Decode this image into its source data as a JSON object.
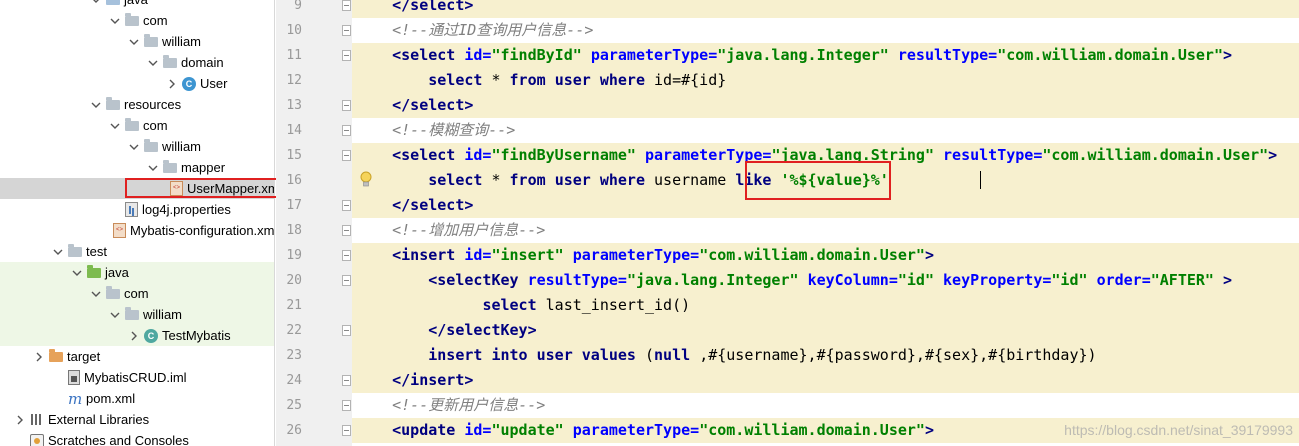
{
  "project_tree": [
    {
      "label": "java",
      "depth": 4,
      "icon": "folder-blue-icon",
      "expanded": true,
      "green": false
    },
    {
      "label": "com",
      "depth": 5,
      "icon": "folder-grey-icon",
      "expanded": true,
      "green": false
    },
    {
      "label": "william",
      "depth": 6,
      "icon": "folder-grey-icon",
      "expanded": true,
      "green": false
    },
    {
      "label": "domain",
      "depth": 7,
      "icon": "folder-grey-icon",
      "expanded": true,
      "green": false
    },
    {
      "label": "User",
      "depth": 8,
      "icon": "class-icon",
      "expanded": false,
      "green": false
    },
    {
      "label": "resources",
      "depth": 4,
      "icon": "folder-grey-icon",
      "expanded": true,
      "green": false
    },
    {
      "label": "com",
      "depth": 5,
      "icon": "folder-grey-icon",
      "expanded": true,
      "green": false
    },
    {
      "label": "william",
      "depth": 6,
      "icon": "folder-grey-icon",
      "expanded": true,
      "green": false
    },
    {
      "label": "mapper",
      "depth": 7,
      "icon": "folder-grey-icon",
      "expanded": true,
      "green": false
    },
    {
      "label": "UserMapper.xml",
      "depth": 8,
      "icon": "xml-file-icon",
      "selected": true,
      "green": false
    },
    {
      "label": "log4j.properties",
      "depth": 5,
      "icon": "properties-file-icon",
      "green": false
    },
    {
      "label": "Mybatis-configuration.xml",
      "depth": 5,
      "icon": "xml-file-icon",
      "green": false
    },
    {
      "label": "test",
      "depth": 2,
      "icon": "folder-grey-icon",
      "expanded": true,
      "green": false
    },
    {
      "label": "java",
      "depth": 3,
      "icon": "folder-green-icon",
      "expanded": true,
      "green": true
    },
    {
      "label": "com",
      "depth": 4,
      "icon": "folder-grey-icon",
      "expanded": true,
      "green": true
    },
    {
      "label": "william",
      "depth": 5,
      "icon": "folder-grey-icon",
      "expanded": true,
      "green": true
    },
    {
      "label": "TestMybatis",
      "depth": 6,
      "icon": "test-class-icon",
      "expanded": false,
      "green": true
    },
    {
      "label": "target",
      "depth": 1,
      "icon": "folder-orange-icon",
      "expanded": false,
      "green": false
    },
    {
      "label": "MybatisCRUD.iml",
      "depth": 2,
      "icon": "iml-file-icon",
      "green": false
    },
    {
      "label": "pom.xml",
      "depth": 2,
      "icon": "maven-icon",
      "green": false
    },
    {
      "label": "External Libraries",
      "depth": 0,
      "icon": "libraries-icon",
      "expanded": false,
      "green": false
    },
    {
      "label": "Scratches and Consoles",
      "depth": 0,
      "icon": "scratches-icon",
      "green": false
    }
  ],
  "code_lines": [
    {
      "n": "9",
      "fold": true,
      "block": true,
      "tokens": [
        [
          "guide",
          "    "
        ],
        [
          "tag",
          "</select>"
        ]
      ]
    },
    {
      "n": "10",
      "fold": true,
      "block": false,
      "tokens": [
        [
          "guide",
          "    "
        ],
        [
          "comment",
          "<!--通过ID查询用户信息-->"
        ]
      ]
    },
    {
      "n": "11",
      "fold": true,
      "block": true,
      "tokens": [
        [
          "guide",
          "    "
        ],
        [
          "tag",
          "<select "
        ],
        [
          "attr",
          "id="
        ],
        [
          "val",
          "\"findById\" "
        ],
        [
          "attr",
          "parameterType="
        ],
        [
          "val",
          "\"java.lang.Integer\" "
        ],
        [
          "attr",
          "resultType="
        ],
        [
          "val",
          "\"com.william.domain.User\""
        ],
        [
          "tag",
          ">"
        ]
      ]
    },
    {
      "n": "12",
      "fold": false,
      "block": true,
      "tokens": [
        [
          "guide",
          "        "
        ],
        [
          "kw",
          "select "
        ],
        [
          "plain",
          "* "
        ],
        [
          "kw",
          "from "
        ],
        [
          "kw",
          "user "
        ],
        [
          "kw",
          "where "
        ],
        [
          "plain",
          "id=#{id}"
        ]
      ]
    },
    {
      "n": "13",
      "fold": true,
      "block": true,
      "tokens": [
        [
          "guide",
          "    "
        ],
        [
          "tag",
          "</select>"
        ]
      ]
    },
    {
      "n": "14",
      "fold": true,
      "block": false,
      "tokens": [
        [
          "guide",
          "    "
        ],
        [
          "comment",
          "<!--模糊查询-->"
        ]
      ]
    },
    {
      "n": "15",
      "fold": true,
      "block": true,
      "tokens": [
        [
          "guide",
          "    "
        ],
        [
          "tag",
          "<select "
        ],
        [
          "attr",
          "id="
        ],
        [
          "val",
          "\"findByUsername\" "
        ],
        [
          "attr",
          "parameterType="
        ],
        [
          "val",
          "\"java.lang.String\" "
        ],
        [
          "attr",
          "resultType="
        ],
        [
          "val",
          "\"com.william.domain.User\""
        ],
        [
          "tag",
          ">"
        ]
      ]
    },
    {
      "n": "16",
      "fold": false,
      "block": true,
      "bulb": true,
      "tokens": [
        [
          "guide",
          "        "
        ],
        [
          "kw",
          "select "
        ],
        [
          "plain",
          "* "
        ],
        [
          "kw",
          "from "
        ],
        [
          "kw",
          "user "
        ],
        [
          "kw",
          "where "
        ],
        [
          "plain",
          "username "
        ],
        [
          "kw",
          "like "
        ],
        [
          "val",
          "'%${value}%'"
        ]
      ]
    },
    {
      "n": "17",
      "fold": true,
      "block": true,
      "tokens": [
        [
          "guide",
          "    "
        ],
        [
          "tag",
          "</select>"
        ]
      ]
    },
    {
      "n": "18",
      "fold": true,
      "block": false,
      "tokens": [
        [
          "guide",
          "    "
        ],
        [
          "comment",
          "<!--增加用户信息-->"
        ]
      ]
    },
    {
      "n": "19",
      "fold": true,
      "block": true,
      "tokens": [
        [
          "guide",
          "    "
        ],
        [
          "tag",
          "<insert "
        ],
        [
          "attr",
          "id="
        ],
        [
          "val",
          "\"insert\" "
        ],
        [
          "attr",
          "parameterType="
        ],
        [
          "val",
          "\"com.william.domain.User\""
        ],
        [
          "tag",
          ">"
        ]
      ]
    },
    {
      "n": "20",
      "fold": true,
      "block": true,
      "tokens": [
        [
          "guide",
          "        "
        ],
        [
          "tag",
          "<selectKey "
        ],
        [
          "attr",
          "resultType="
        ],
        [
          "val",
          "\"java.lang.Integer\" "
        ],
        [
          "attr",
          "keyColumn="
        ],
        [
          "val",
          "\"id\" "
        ],
        [
          "attr",
          "keyProperty="
        ],
        [
          "val",
          "\"id\" "
        ],
        [
          "attr",
          "order="
        ],
        [
          "val",
          "\"AFTER\" "
        ],
        [
          "tag",
          ">"
        ]
      ]
    },
    {
      "n": "21",
      "fold": false,
      "block": true,
      "tokens": [
        [
          "guide",
          "              "
        ],
        [
          "kw",
          "select "
        ],
        [
          "plain",
          "last_insert_id()"
        ]
      ]
    },
    {
      "n": "22",
      "fold": true,
      "block": true,
      "tokens": [
        [
          "guide",
          "        "
        ],
        [
          "tag",
          "</selectKey>"
        ]
      ]
    },
    {
      "n": "23",
      "fold": false,
      "block": true,
      "tokens": [
        [
          "guide",
          "        "
        ],
        [
          "kw",
          "insert "
        ],
        [
          "kw",
          "into "
        ],
        [
          "kw",
          "user "
        ],
        [
          "kw",
          "values "
        ],
        [
          "plain",
          "("
        ],
        [
          "kw",
          "null "
        ],
        [
          "plain",
          ",#{username},#{password},#{sex},#{birthday})"
        ]
      ]
    },
    {
      "n": "24",
      "fold": true,
      "block": true,
      "tokens": [
        [
          "guide",
          "    "
        ],
        [
          "tag",
          "</insert>"
        ]
      ]
    },
    {
      "n": "25",
      "fold": true,
      "block": false,
      "tokens": [
        [
          "guide",
          "    "
        ],
        [
          "comment",
          "<!--更新用户信息-->"
        ]
      ]
    },
    {
      "n": "26",
      "fold": true,
      "block": true,
      "tokens": [
        [
          "guide",
          "    "
        ],
        [
          "tag",
          "<update "
        ],
        [
          "attr",
          "id="
        ],
        [
          "val",
          "\"update\" "
        ],
        [
          "attr",
          "parameterType="
        ],
        [
          "val",
          "\"com.william.domain.User\""
        ],
        [
          "tag",
          ">"
        ]
      ]
    }
  ],
  "watermark": "https://blog.csdn.net/sinat_39179993",
  "colors": {
    "tag": "#000080",
    "attribute": "#0000ff",
    "string": "#008000",
    "comment": "#808080",
    "block_highlight": "#f7f0cf",
    "annotation_box": "#e02020",
    "test_folder_bg": "#eef7e6"
  }
}
